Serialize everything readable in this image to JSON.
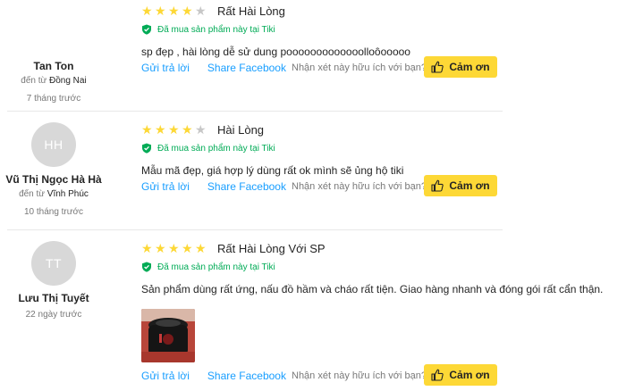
{
  "labels": {
    "verified": "Đã mua sản phẩm này tại Tiki",
    "reply": "Gửi trả lời",
    "share": "Share Facebook",
    "helpful_question": "Nhận xét này hữu ích với bạn?",
    "thanks": "Cảm ơn",
    "from_prefix": "đến từ"
  },
  "colors": {
    "star_on": "#fdd836",
    "star_off": "#c7c7c7",
    "verified_green": "#00ab56",
    "link_blue": "#189eff",
    "thanks_button": "#fdd836",
    "avatar_bg": "#d8d8d8"
  },
  "reviews": [
    {
      "author": {
        "name": "Tan Ton",
        "initials": "",
        "location": "Đồng Nai",
        "time": "7 tháng trước"
      },
      "rating": 4,
      "title": "Rất Hài Lòng",
      "comment": "sp đẹp , hài lòng dễ sử dung pooooooooooooolloôooooo",
      "has_photo": false
    },
    {
      "author": {
        "name": "Vũ Thị Ngọc Hà Hà",
        "initials": "HH",
        "location": "Vĩnh Phúc",
        "time": "10 tháng trước"
      },
      "rating": 4,
      "title": "Hài Lòng",
      "comment": "Mẫu mã đẹp, giá hợp lý dùng rất ok mình sẽ ủng hộ tiki",
      "has_photo": false
    },
    {
      "author": {
        "name": "Lưu Thị Tuyết",
        "initials": "TT",
        "location": "",
        "time": "22 ngày trước"
      },
      "rating": 5,
      "title": "Rất Hài Lòng Với SP",
      "comment": "Sản phẩm dùng rất ứng, nấu đồ hầm và cháo rất tiện. Giao hàng nhanh và đóng gói rất cẩn thận.",
      "has_photo": true
    }
  ]
}
